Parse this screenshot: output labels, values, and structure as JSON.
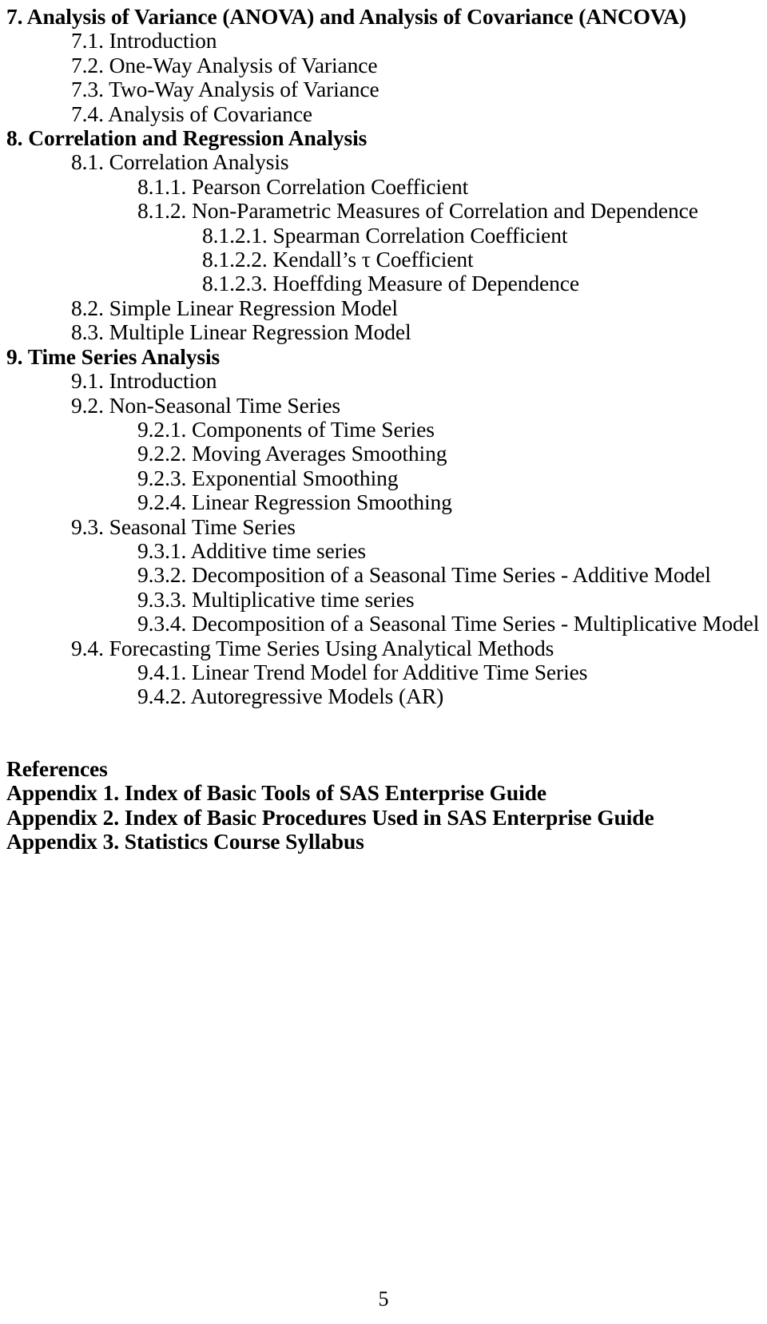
{
  "document": {
    "page_number": "5"
  },
  "toc": {
    "entries": [
      {
        "level": 1,
        "text": "7. Analysis of Variance (ANOVA) and Analysis of Covariance (ANCOVA)"
      },
      {
        "level": 2,
        "text": "7.1. Introduction"
      },
      {
        "level": 2,
        "text": "7.2. One-Way Analysis of Variance"
      },
      {
        "level": 2,
        "text": "7.3. Two-Way Analysis of Variance"
      },
      {
        "level": 2,
        "text": "7.4. Analysis of Covariance"
      },
      {
        "level": 1,
        "text": "8. Correlation and Regression Analysis"
      },
      {
        "level": 2,
        "text": "8.1. Correlation Analysis"
      },
      {
        "level": 3,
        "text": "8.1.1. Pearson Correlation Coefficient"
      },
      {
        "level": 3,
        "text": "8.1.2. Non-Parametric Measures of Correlation and Dependence"
      },
      {
        "level": 4,
        "text": "8.1.2.1. Spearman Correlation Coefficient"
      },
      {
        "level": 4,
        "text": "8.1.2.2. Kendall’s τ Coefficient"
      },
      {
        "level": 4,
        "text": "8.1.2.3. Hoeffding Measure of Dependence"
      },
      {
        "level": 2,
        "text": "8.2. Simple Linear Regression Model"
      },
      {
        "level": 2,
        "text": "8.3. Multiple Linear Regression Model"
      },
      {
        "level": 1,
        "text": "9. Time Series Analysis"
      },
      {
        "level": 2,
        "text": "9.1. Introduction"
      },
      {
        "level": 2,
        "text": "9.2. Non-Seasonal Time Series"
      },
      {
        "level": 3,
        "text": "9.2.1. Components of Time Series"
      },
      {
        "level": 3,
        "text": "9.2.2. Moving Averages Smoothing"
      },
      {
        "level": 3,
        "text": "9.2.3. Exponential Smoothing"
      },
      {
        "level": 3,
        "text": "9.2.4. Linear Regression Smoothing"
      },
      {
        "level": 2,
        "text": "9.3. Seasonal Time Series"
      },
      {
        "level": 3,
        "text": "9.3.1. Additive time series"
      },
      {
        "level": 3,
        "text": "9.3.2. Decomposition of a Seasonal Time Series - Additive Model"
      },
      {
        "level": 3,
        "text": "9.3.3. Multiplicative time series"
      },
      {
        "level": 3,
        "text": "9.3.4. Decomposition of a Seasonal Time Series - Multiplicative Model"
      },
      {
        "level": 2,
        "text": "9.4. Forecasting Time Series Using Analytical Methods"
      },
      {
        "level": 3,
        "text": "9.4.1. Linear Trend Model for Additive Time Series"
      },
      {
        "level": 3,
        "text": "9.4.2. Autoregressive Models (AR)"
      }
    ]
  },
  "backmatter": {
    "entries": [
      {
        "text": "References"
      },
      {
        "text": "Appendix 1. Index of Basic Tools of SAS Enterprise Guide"
      },
      {
        "text": "Appendix 2. Index of Basic Procedures Used in SAS Enterprise Guide"
      },
      {
        "text": "Appendix 3. Statistics Course Syllabus"
      }
    ]
  }
}
